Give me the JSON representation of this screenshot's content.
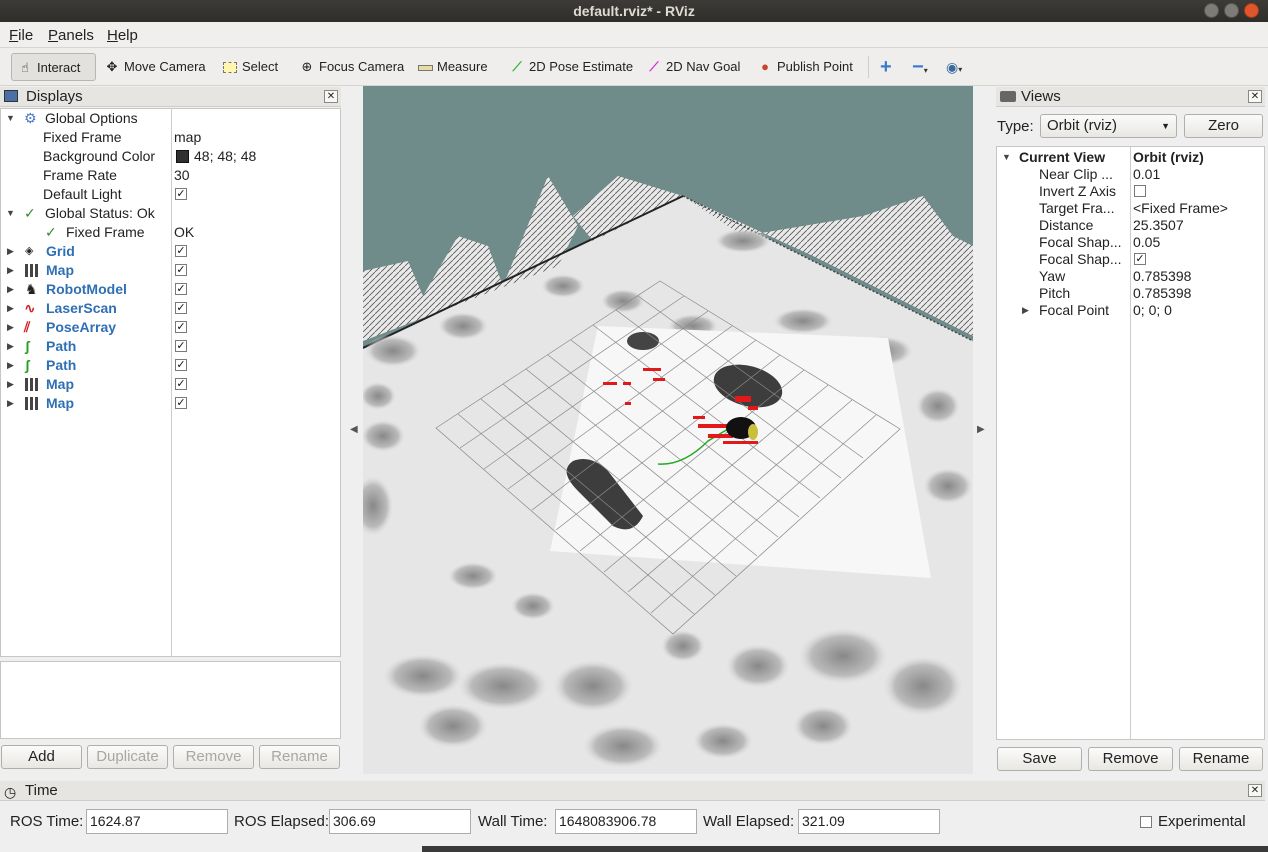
{
  "window": {
    "title": "default.rviz* - RViz"
  },
  "menu": [
    {
      "mn": "F",
      "rest": "ile"
    },
    {
      "mn": "P",
      "rest": "anels"
    },
    {
      "mn": "H",
      "rest": "elp"
    }
  ],
  "toolbar": {
    "interact": "Interact",
    "move_camera": "Move Camera",
    "select": "Select",
    "focus_camera": "Focus Camera",
    "measure": "Measure",
    "pose_estimate": "2D Pose Estimate",
    "nav_goal": "2D Nav Goal",
    "publish_point": "Publish Point",
    "plus": "+",
    "minus": "−",
    "eye": "◉"
  },
  "displays": {
    "title": "Displays",
    "global_options": {
      "label": "Global Options",
      "fixed_frame_label": "Fixed Frame",
      "fixed_frame": "map",
      "bg_label": "Background Color",
      "bg_value": "48; 48; 48",
      "frame_rate_label": "Frame Rate",
      "frame_rate": "30",
      "default_light_label": "Default Light"
    },
    "global_status": {
      "label": "Global Status: Ok",
      "fixed_frame_label": "Fixed Frame",
      "fixed_frame_value": "OK"
    },
    "items": [
      "Grid",
      "Map",
      "RobotModel",
      "LaserScan",
      "PoseArray",
      "Path",
      "Path",
      "Map",
      "Map"
    ],
    "buttons": {
      "add": "Add",
      "duplicate": "Duplicate",
      "remove": "Remove",
      "rename": "Rename"
    }
  },
  "views": {
    "title": "Views",
    "type_label": "Type:",
    "type_value": "Orbit (rviz)",
    "zero": "Zero",
    "current_view": "Current View",
    "current_view_value": "Orbit (rviz)",
    "props": [
      {
        "k": "Near Clip ...",
        "v": "0.01"
      },
      {
        "k": "Invert Z Axis",
        "v": ""
      },
      {
        "k": "Target Fra...",
        "v": "<Fixed Frame>"
      },
      {
        "k": "Distance",
        "v": "25.3507"
      },
      {
        "k": "Focal Shap...",
        "v": "0.05"
      },
      {
        "k": "Focal Shap...",
        "v": ""
      },
      {
        "k": "Yaw",
        "v": "0.785398"
      },
      {
        "k": "Pitch",
        "v": "0.785398"
      },
      {
        "k": "Focal Point",
        "v": "0; 0; 0"
      }
    ],
    "buttons": {
      "save": "Save",
      "remove": "Remove",
      "rename": "Rename"
    }
  },
  "time": {
    "title": "Time",
    "ros_time_label": "ROS Time:",
    "ros_time": "1624.87",
    "ros_elapsed_label": "ROS Elapsed:",
    "ros_elapsed": "306.69",
    "wall_time_label": "Wall Time:",
    "wall_time": "1648083906.78",
    "wall_elapsed_label": "Wall Elapsed:",
    "wall_elapsed": "321.09",
    "experimental": "Experimental"
  },
  "colors": {
    "background_swatch": "#303030",
    "display_blue": "#2f6fb3",
    "scene_sky": "#6f8b8a"
  }
}
